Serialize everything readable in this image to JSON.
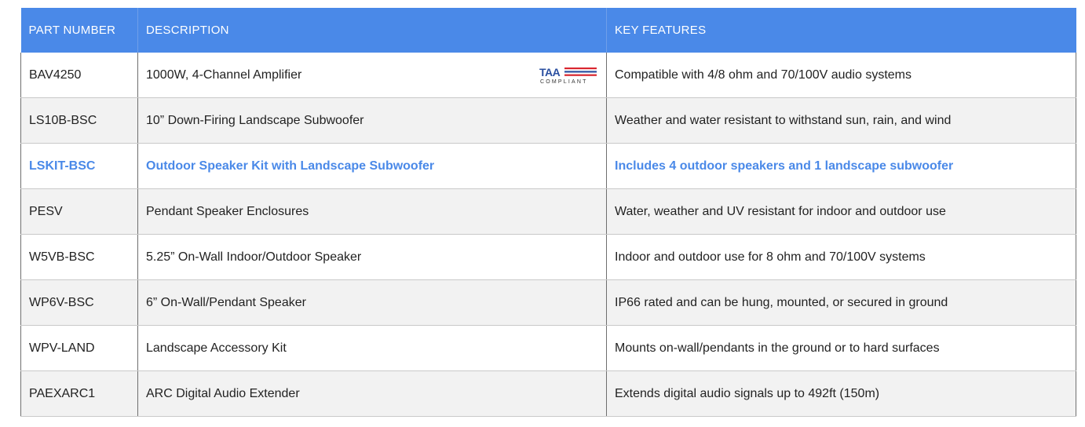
{
  "table": {
    "headers": {
      "part_number": "PART NUMBER",
      "description": "DESCRIPTION",
      "key_features": "KEY FEATURES"
    },
    "rows": [
      {
        "part_number": "BAV4250",
        "description": "1000W, 4-Channel Amplifier",
        "key_features": "Compatible with 4/8 ohm and 70/100V audio systems",
        "badge": {
          "top": "TAA",
          "bottom": "COMPLIANT",
          "colors": {
            "red": "#d8262f",
            "blue": "#2a4fa0"
          }
        }
      },
      {
        "part_number": "LS10B-BSC",
        "description": "10” Down-Firing Landscape Subwoofer",
        "key_features": "Weather and water resistant to withstand sun, rain, and wind"
      },
      {
        "part_number": "LSKIT-BSC",
        "description": "Outdoor Speaker Kit with Landscape Subwoofer",
        "key_features": "Includes 4 outdoor speakers and 1 landscape subwoofer",
        "highlighted": true
      },
      {
        "part_number": "PESV",
        "description": "Pendant Speaker Enclosures",
        "key_features": "Water, weather and UV resistant for indoor and outdoor use"
      },
      {
        "part_number": "W5VB-BSC",
        "description": "5.25” On-Wall Indoor/Outdoor Speaker",
        "key_features": "Indoor and outdoor use for 8 ohm and 70/100V systems"
      },
      {
        "part_number": "WP6V-BSC",
        "description": "6” On-Wall/Pendant Speaker",
        "key_features": "IP66 rated and can be hung, mounted, or secured in ground"
      },
      {
        "part_number": "WPV-LAND",
        "description": "Landscape Accessory Kit",
        "key_features": "Mounts on-wall/pendants in the ground or to hard surfaces"
      },
      {
        "part_number": "PAEXARC1",
        "description": "ARC Digital Audio Extender",
        "key_features": "Extends digital audio signals up to 492ft (150m)"
      }
    ]
  },
  "colors": {
    "header_bg": "#4a89e8",
    "highlight_text": "#4a89e8",
    "row_alt_bg": "#f2f2f2"
  }
}
